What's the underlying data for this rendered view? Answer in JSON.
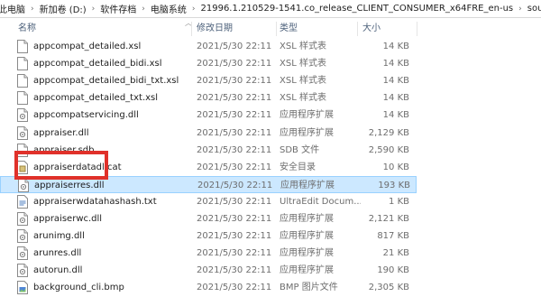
{
  "breadcrumb": [
    "此电脑",
    "新加卷 (D:)",
    "软件存档",
    "电脑系统",
    "21996.1.210529-1541.co_release_CLIENT_CONSUMER_x64FRE_en-us",
    "sources"
  ],
  "columns": {
    "name": "名称",
    "date": "修改日期",
    "type": "类型",
    "size": "大小"
  },
  "files": [
    {
      "name": "appcompat_detailed.xsl",
      "date": "2021/5/30 22:11",
      "type": "XSL 样式表",
      "size": "14 KB",
      "icon": "xsl-file-icon"
    },
    {
      "name": "appcompat_detailed_bidi.xsl",
      "date": "2021/5/30 22:11",
      "type": "XSL 样式表",
      "size": "14 KB",
      "icon": "xsl-file-icon"
    },
    {
      "name": "appcompat_detailed_bidi_txt.xsl",
      "date": "2021/5/30 22:11",
      "type": "XSL 样式表",
      "size": "14 KB",
      "icon": "xsl-file-icon"
    },
    {
      "name": "appcompat_detailed_txt.xsl",
      "date": "2021/5/30 22:11",
      "type": "XSL 样式表",
      "size": "14 KB",
      "icon": "xsl-file-icon"
    },
    {
      "name": "appcompatservicing.dll",
      "date": "2021/5/30 22:11",
      "type": "应用程序扩展",
      "size": "14 KB",
      "icon": "dll-file-icon"
    },
    {
      "name": "appraiser.dll",
      "date": "2021/5/30 22:11",
      "type": "应用程序扩展",
      "size": "2,129 KB",
      "icon": "dll-file-icon"
    },
    {
      "name": "appraiser.sdb",
      "date": "2021/5/30 22:11",
      "type": "SDB 文件",
      "size": "2,590 KB",
      "icon": "sdb-file-icon"
    },
    {
      "name": "appraiserdatadl.cat",
      "date": "2021/5/30 22:11",
      "type": "安全目录",
      "size": "10 KB",
      "icon": "cat-file-icon"
    },
    {
      "name": "appraiserres.dll",
      "date": "2021/5/30 22:11",
      "type": "应用程序扩展",
      "size": "193 KB",
      "icon": "dll-file-icon",
      "selected": true
    },
    {
      "name": "appraiserwdatahashash.txt",
      "date": "2021/5/30 22:11",
      "type": "UltraEdit Docum...",
      "size": "1 KB",
      "icon": "txt-file-icon"
    },
    {
      "name": "appraiserwc.dll",
      "date": "2021/5/30 22:11",
      "type": "应用程序扩展",
      "size": "2,121 KB",
      "icon": "dll-file-icon"
    },
    {
      "name": "arunimg.dll",
      "date": "2021/5/30 22:11",
      "type": "应用程序扩展",
      "size": "817 KB",
      "icon": "dll-file-icon"
    },
    {
      "name": "arunres.dll",
      "date": "2021/5/30 22:11",
      "type": "应用程序扩展",
      "size": "21 KB",
      "icon": "dll-file-icon"
    },
    {
      "name": "autorun.dll",
      "date": "2021/5/30 22:11",
      "type": "应用程序扩展",
      "size": "190 KB",
      "icon": "dll-file-icon"
    },
    {
      "name": "background_cli.bmp",
      "date": "2021/5/30 22:11",
      "type": "BMP 图片文件",
      "size": "2,305 KB",
      "icon": "bmp-file-icon"
    }
  ],
  "colors": {
    "selection": "#cce8ff",
    "selection_border": "#99d1ff",
    "highlight": "#e0312a",
    "header_text": "#4c607a"
  }
}
